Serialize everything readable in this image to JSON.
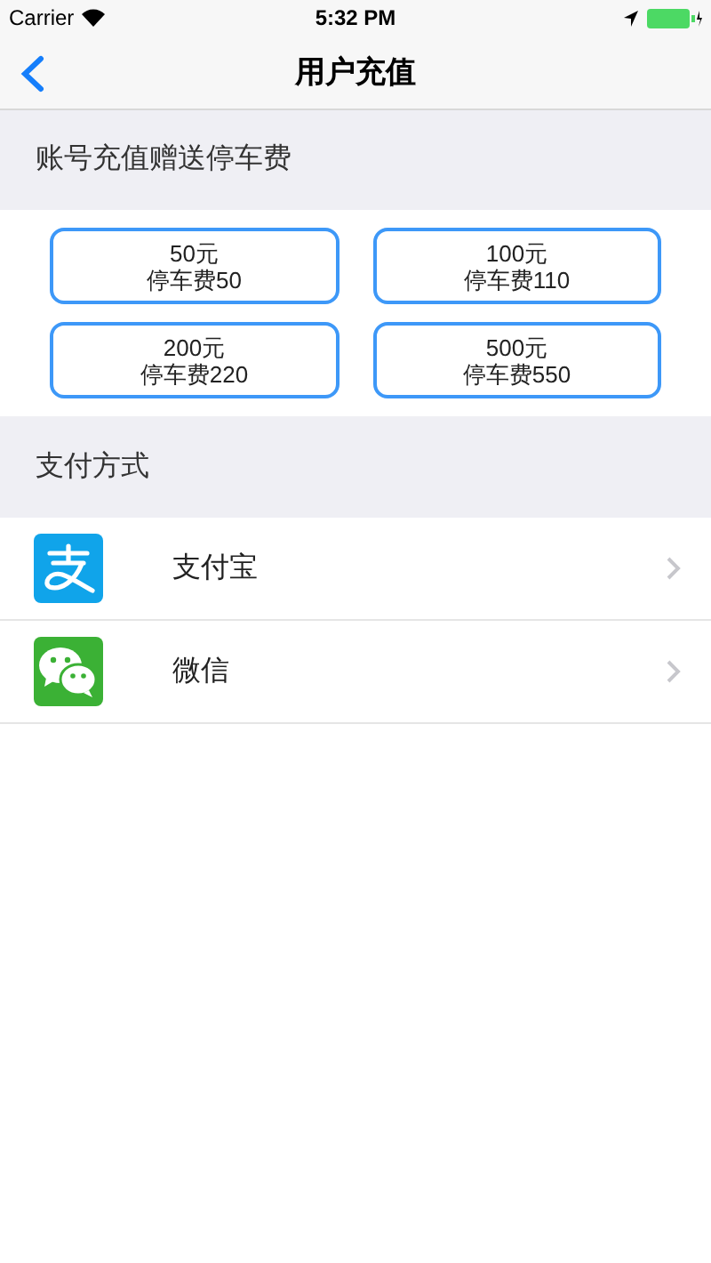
{
  "status_bar": {
    "carrier": "Carrier",
    "time": "5:32 PM"
  },
  "nav": {
    "title": "用户充值"
  },
  "recharge_section": {
    "header": "账号充值赠送停车费",
    "options": [
      {
        "amount": "50元",
        "bonus": "停车费50"
      },
      {
        "amount": "100元",
        "bonus": "停车费110"
      },
      {
        "amount": "200元",
        "bonus": "停车费220"
      },
      {
        "amount": "500元",
        "bonus": "停车费550"
      }
    ]
  },
  "payment_section": {
    "header": "支付方式",
    "methods": [
      {
        "kind": "alipay",
        "label": "支付宝"
      },
      {
        "kind": "wechat",
        "label": "微信"
      }
    ]
  }
}
